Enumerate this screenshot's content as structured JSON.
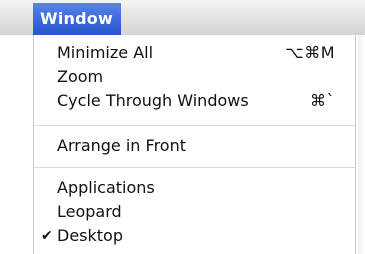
{
  "menubar": {
    "menu_title": "Window"
  },
  "menu": {
    "items": [
      {
        "label": "Minimize All",
        "shortcut": "⌥⌘M"
      },
      {
        "label": "Zoom",
        "shortcut": ""
      },
      {
        "label": "Cycle Through Windows",
        "shortcut": "⌘`"
      },
      {
        "label": "Arrange in Front",
        "shortcut": ""
      },
      {
        "label": "Applications",
        "shortcut": ""
      },
      {
        "label": "Leopard",
        "shortcut": ""
      },
      {
        "label": "Desktop",
        "shortcut": "",
        "checked": true,
        "check_glyph": "✔"
      }
    ]
  },
  "colors": {
    "menu_title_highlight": "#3a67d9",
    "menubar_background": "#e2e2e2",
    "text": "#111111",
    "separator": "#dadada"
  }
}
